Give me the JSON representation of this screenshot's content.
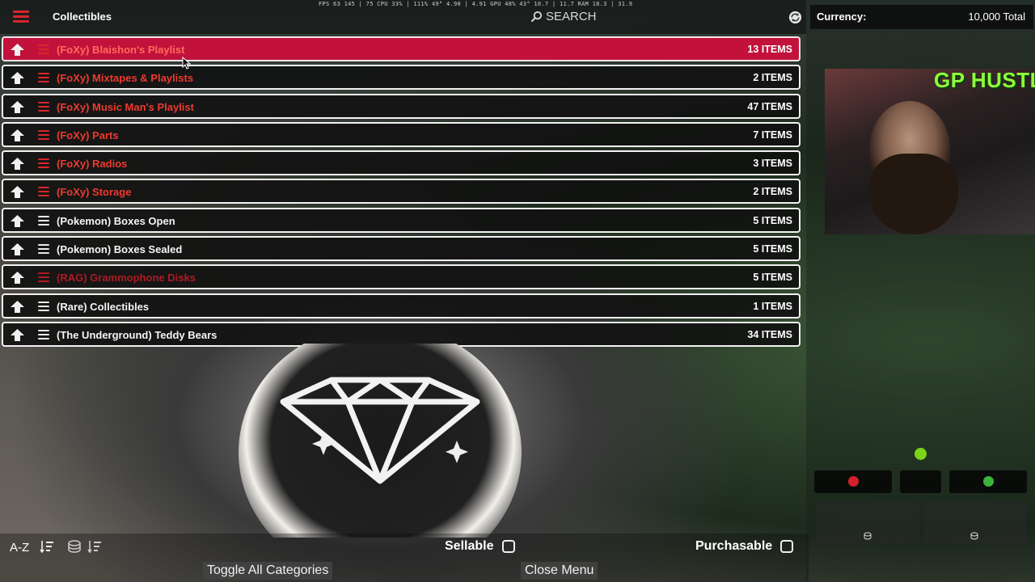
{
  "header": {
    "title": "Collectibles",
    "perf_overlay": "FPS 63   145 | 75       CPU 33% | 111%      49°   4.90 | 4.91   GPU 48%   43°   10.7 | 11.7   RAM 18.3 | 31.9",
    "search_placeholder": "SEARCH"
  },
  "categories": [
    {
      "name": "(FoXy) Blaishon's Playlist",
      "count": "13 ITEMS",
      "style": "red",
      "active": true
    },
    {
      "name": "(FoXy) Mixtapes & Playlists",
      "count": "2 ITEMS",
      "style": "red",
      "active": false
    },
    {
      "name": "(FoXy) Music Man's Playlist",
      "count": "47 ITEMS",
      "style": "red",
      "active": false
    },
    {
      "name": "(FoXy) Parts",
      "count": "7 ITEMS",
      "style": "red",
      "active": false
    },
    {
      "name": "(FoXy) Radios",
      "count": "3 ITEMS",
      "style": "red",
      "active": false
    },
    {
      "name": "(FoXy) Storage",
      "count": "2 ITEMS",
      "style": "red",
      "active": false
    },
    {
      "name": "(Pokemon) Boxes Open",
      "count": "5 ITEMS",
      "style": "white",
      "active": false
    },
    {
      "name": "(Pokemon) Boxes Sealed",
      "count": "5 ITEMS",
      "style": "white",
      "active": false
    },
    {
      "name": "(RAG) Grammophone Disks",
      "count": "5 ITEMS",
      "style": "dim",
      "active": false
    },
    {
      "name": "(Rare) Collectibles",
      "count": "1 ITEMS",
      "style": "white",
      "active": false
    },
    {
      "name": "(The Underground) Teddy Bears",
      "count": "34 ITEMS",
      "style": "white",
      "active": false
    }
  ],
  "footer": {
    "sort_label": "A-Z",
    "sellable_label": "Sellable",
    "purchasable_label": "Purchasable",
    "toggle_all_label": "Toggle All Categories",
    "close_menu_label": "Close Menu"
  },
  "panel": {
    "currency_label": "Currency:",
    "currency_value": "10,000 Total",
    "webcam_overlay_text": "GP HUSTLA"
  },
  "colors": {
    "accent_red": "#c2123b",
    "category_red": "#ee3a2f",
    "plus_green": "#3bb43b",
    "minus_red": "#d4202a"
  }
}
